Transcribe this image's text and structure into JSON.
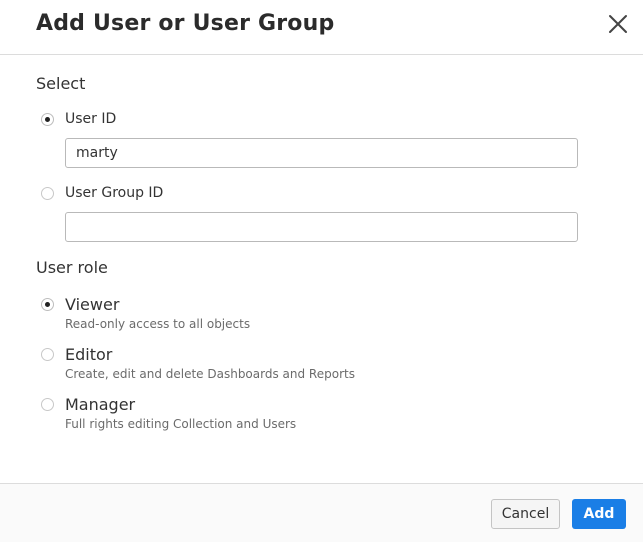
{
  "dialog": {
    "title": "Add User or User Group",
    "close_icon": "close-icon"
  },
  "select_section": {
    "label": "Select",
    "options": [
      {
        "label": "User ID",
        "selected": true,
        "input_value": "marty"
      },
      {
        "label": "User Group ID",
        "selected": false,
        "input_value": ""
      }
    ]
  },
  "role_section": {
    "label": "User role",
    "roles": [
      {
        "label": "Viewer",
        "description": "Read-only access to all objects",
        "selected": true
      },
      {
        "label": "Editor",
        "description": "Create, edit and delete Dashboards and Reports",
        "selected": false
      },
      {
        "label": "Manager",
        "description": "Full rights editing Collection and Users",
        "selected": false
      }
    ]
  },
  "footer": {
    "cancel_label": "Cancel",
    "add_label": "Add"
  },
  "colors": {
    "primary": "#1a7ee6",
    "border": "#dcdcdc"
  }
}
